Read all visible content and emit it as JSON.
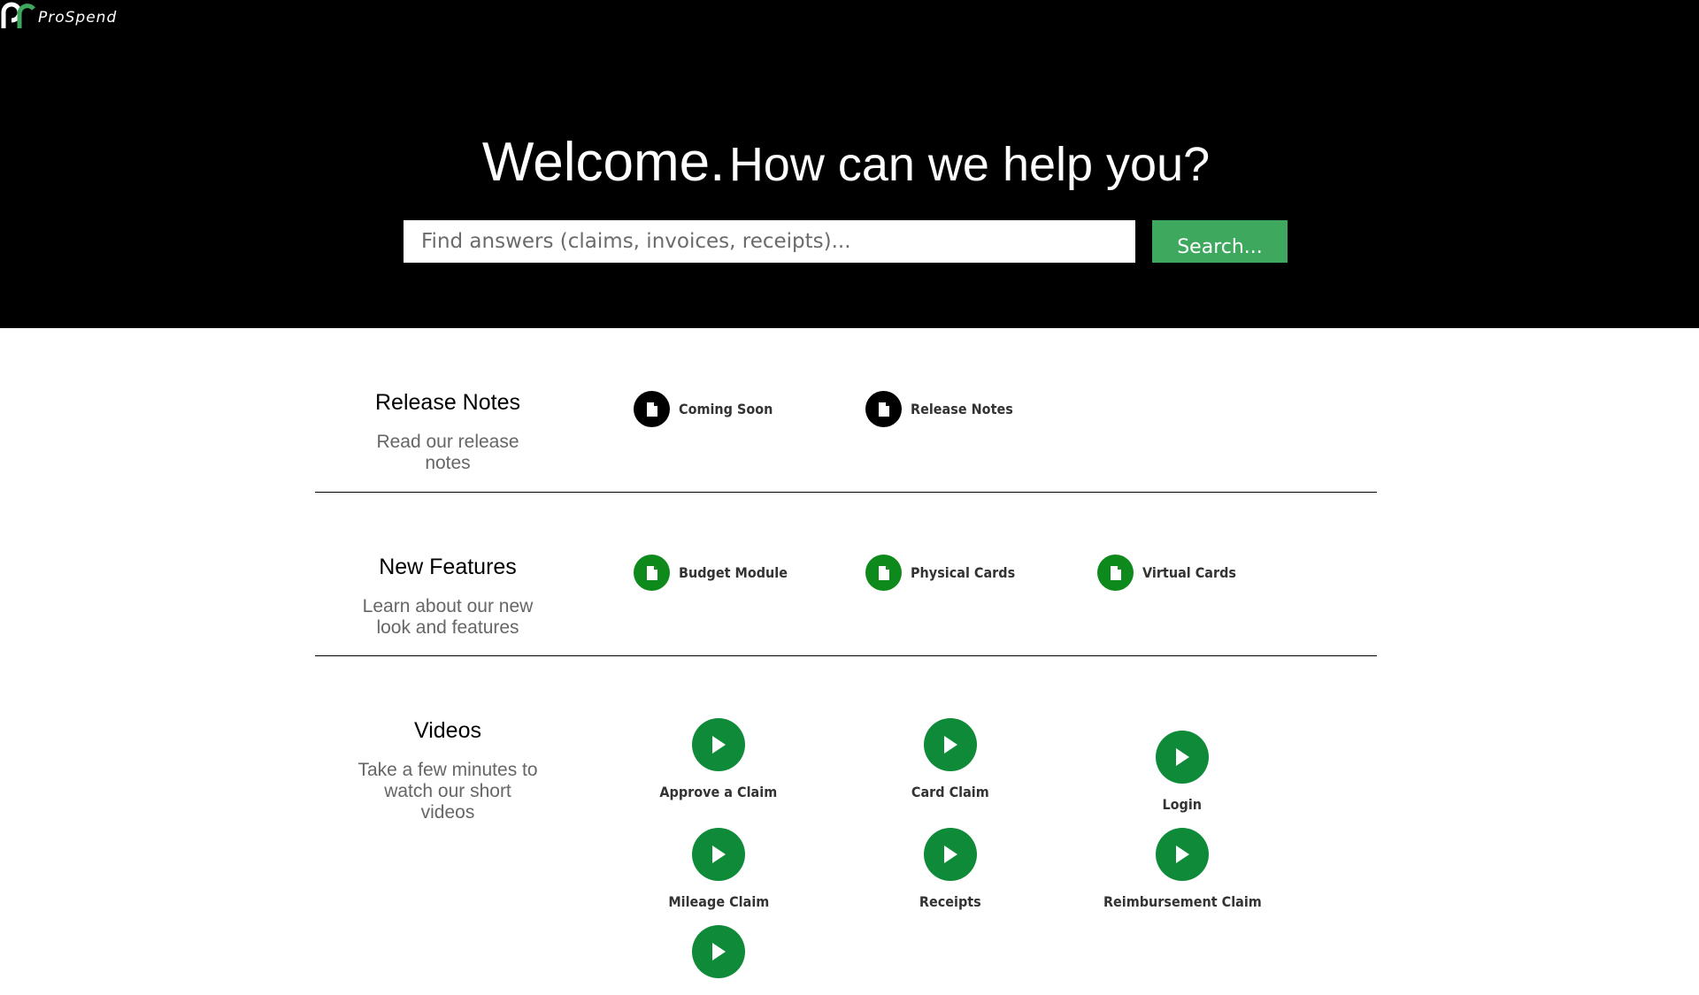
{
  "brand": {
    "name": "ProSpend",
    "logo_text": "ProSpend"
  },
  "hero": {
    "headline_big": "Welcome.",
    "headline_small": "How can we help you?",
    "search_placeholder": "Find answers (claims, invoices, receipts)...",
    "search_button": "Search..."
  },
  "colors": {
    "hero_bg": "#000000",
    "search_button_bg": "#3ea95e",
    "feature_icon_bg": "#0e8a1c",
    "video_icon_bg": "#0e8a38",
    "release_icon_bg": "#000000"
  },
  "sections": {
    "release_notes": {
      "title": "Release Notes",
      "description": "Read our release notes",
      "items": [
        {
          "label": "Coming Soon",
          "icon": "document-icon"
        },
        {
          "label": "Release Notes",
          "icon": "document-icon"
        }
      ]
    },
    "new_features": {
      "title": "New Features",
      "description": "Learn about our new look and features",
      "items": [
        {
          "label": "Budget Module",
          "icon": "document-icon"
        },
        {
          "label": "Physical Cards",
          "icon": "document-icon"
        },
        {
          "label": "Virtual Cards",
          "icon": "document-icon"
        }
      ]
    },
    "videos": {
      "title": "Videos",
      "description": "Take a few minutes to watch our short videos",
      "items": [
        {
          "label": "Approve a Claim",
          "icon": "play-icon"
        },
        {
          "label": "Card Claim",
          "icon": "play-icon"
        },
        {
          "label": "Login",
          "icon": "play-icon"
        },
        {
          "label": "Mileage Claim",
          "icon": "play-icon"
        },
        {
          "label": "Receipts",
          "icon": "play-icon"
        },
        {
          "label": "Reimbursement Claim",
          "icon": "play-icon"
        },
        {
          "label": "",
          "icon": "play-icon"
        }
      ]
    }
  }
}
